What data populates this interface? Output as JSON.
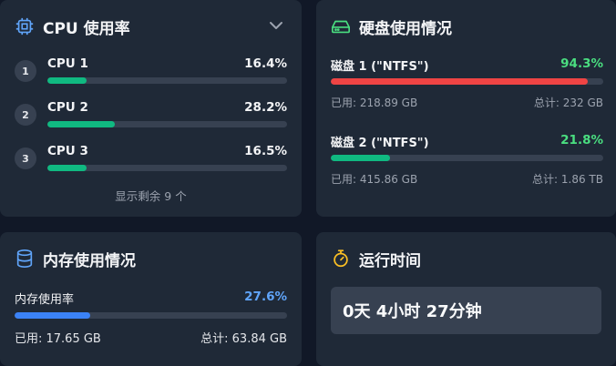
{
  "cpu": {
    "title": "CPU 使用率",
    "icon": "cpu-icon",
    "items": [
      {
        "index": "1",
        "name": "CPU 1",
        "pct_label": "16.4%",
        "value": 16.4
      },
      {
        "index": "2",
        "name": "CPU 2",
        "pct_label": "28.2%",
        "value": 28.2
      },
      {
        "index": "3",
        "name": "CPU 3",
        "pct_label": "16.5%",
        "value": 16.5
      }
    ],
    "more": "显示剩余 9 个"
  },
  "disk": {
    "title": "硬盘使用情况",
    "icon": "hard-drive-icon",
    "items": [
      {
        "name": "磁盘 1 (\"NTFS\")",
        "pct_label": "94.3%",
        "value": 94.3,
        "used": "已用: 218.89 GB",
        "total": "总计: 232 GB",
        "color": "#ef4444",
        "text_color": "#4ade80"
      },
      {
        "name": "磁盘 2 (\"NTFS\")",
        "pct_label": "21.8%",
        "value": 21.8,
        "used": "已用: 415.86 GB",
        "total": "总计: 1.86 TB",
        "color": "#10b981",
        "text_color": "#4ade80"
      }
    ]
  },
  "memory": {
    "title": "内存使用情况",
    "icon": "database-icon",
    "label": "内存使用率",
    "pct_label": "27.6%",
    "value": 27.6,
    "used": "已用: 17.65 GB",
    "total": "总计: 63.84 GB"
  },
  "uptime": {
    "title": "运行时间",
    "icon": "stopwatch-icon",
    "value": "0天 4小时 27分钟"
  },
  "colors": {
    "cpu_bar": "#10b981",
    "mem_bar": "#3b82f6",
    "cpu_icon": "#60a5fa",
    "disk_icon": "#4ade80",
    "mem_icon": "#60a5fa",
    "uptime_icon": "#fbbf24"
  }
}
